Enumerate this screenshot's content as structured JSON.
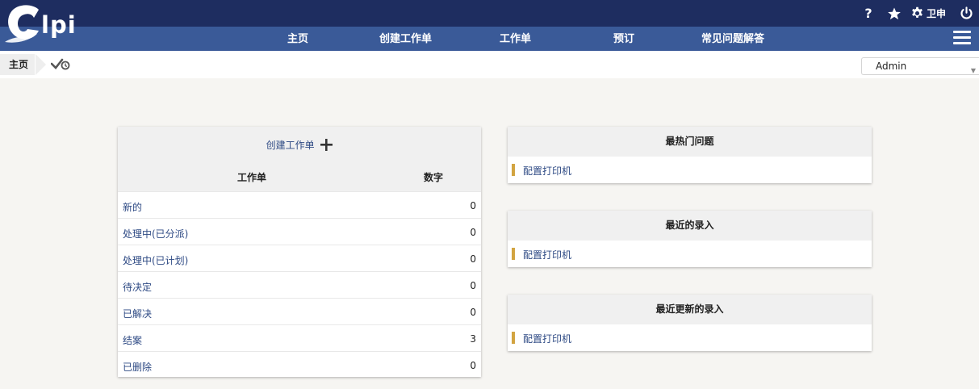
{
  "header": {
    "logo_text": "lpi",
    "help_label": "?",
    "prefs_label": "卫申",
    "icons": [
      "help-icon",
      "star-icon",
      "gear-icon",
      "power-icon",
      "menu-icon"
    ]
  },
  "nav": {
    "items": [
      "主页",
      "创建工作单",
      "工作单",
      "预订",
      "常见问题解答"
    ]
  },
  "breadcrumb": {
    "home_label": "主页"
  },
  "profile": {
    "selected": "Admin"
  },
  "tickets": {
    "create_label": "创建工作单",
    "col_ticket": "工作单",
    "col_count": "数字",
    "rows": [
      {
        "label": "新的",
        "value": "0"
      },
      {
        "label": "处理中(已分派)",
        "value": "0"
      },
      {
        "label": "处理中(已计划)",
        "value": "0"
      },
      {
        "label": "待决定",
        "value": "0"
      },
      {
        "label": "已解决",
        "value": "0"
      },
      {
        "label": "结案",
        "value": "3"
      },
      {
        "label": "已删除",
        "value": "0"
      }
    ]
  },
  "faq": {
    "popular": {
      "title": "最热门问题",
      "items": [
        "配置打印机"
      ]
    },
    "recent": {
      "title": "最近的录入",
      "items": [
        "配置打印机"
      ]
    },
    "updated": {
      "title": "最近更新的录入",
      "items": [
        "配置打印机"
      ]
    }
  },
  "colors": {
    "topbar": "#1e2d60",
    "navbar": "#3a5a98",
    "link": "#2e4a84",
    "accent_bar": "#d2a441",
    "background": "#f6f5f2"
  }
}
